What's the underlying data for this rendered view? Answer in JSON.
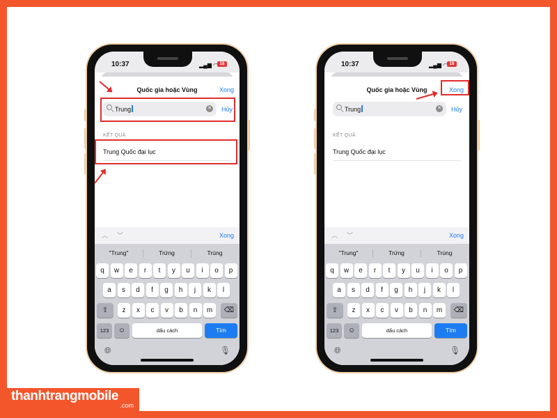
{
  "brand": {
    "name": "thanhtrangmobile",
    "domain": ".com"
  },
  "status": {
    "time": "10:37",
    "battery": "18"
  },
  "sheet": {
    "title": "Quốc gia hoặc Vùng",
    "done": "Xong"
  },
  "search": {
    "value": "Trung",
    "cancel": "Hủy"
  },
  "results": {
    "header": "KẾT QUẢ",
    "items": [
      "Trung Quốc đại lục"
    ]
  },
  "keyboard": {
    "done": "Xong",
    "suggestions": [
      "\"Trung\"",
      "Trứng",
      "Trúng"
    ],
    "row1": [
      "q",
      "w",
      "e",
      "r",
      "t",
      "y",
      "u",
      "i",
      "o",
      "p"
    ],
    "row2": [
      "a",
      "s",
      "d",
      "f",
      "g",
      "h",
      "j",
      "k",
      "l"
    ],
    "row3": [
      "z",
      "x",
      "c",
      "v",
      "b",
      "n",
      "m"
    ],
    "numbers_key": "123",
    "space": "dấu cách",
    "go": "Tìm"
  },
  "colors": {
    "accent": "#1e7cf2",
    "highlight": "#e12c2c",
    "brand": "#f4562c"
  }
}
